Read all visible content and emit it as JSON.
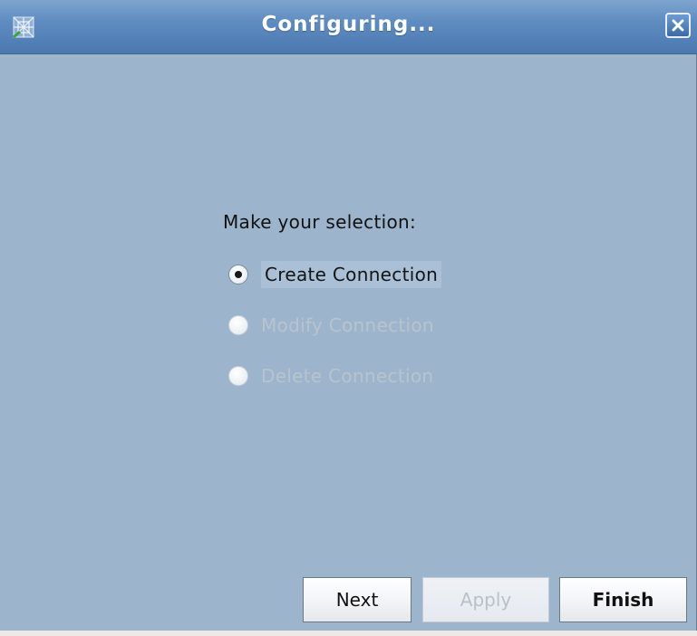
{
  "window": {
    "title": "Configuring...",
    "app_icon": "network-cube-icon",
    "close_icon": "close-icon"
  },
  "dialog": {
    "prompt": "Make your selection:",
    "options": [
      {
        "label": "Create Connection",
        "selected": true,
        "enabled": true
      },
      {
        "label": "Modify Connection",
        "selected": false,
        "enabled": false
      },
      {
        "label": "Delete Connection",
        "selected": false,
        "enabled": false
      }
    ]
  },
  "buttons": {
    "next": {
      "label": "Next",
      "enabled": true
    },
    "apply": {
      "label": "Apply",
      "enabled": false
    },
    "finish": {
      "label": "Finish",
      "enabled": true
    }
  },
  "colors": {
    "titlebar": "#4a78b0",
    "dialog_background": "#9db5cc",
    "disabled_text": "#b9c3ce"
  }
}
